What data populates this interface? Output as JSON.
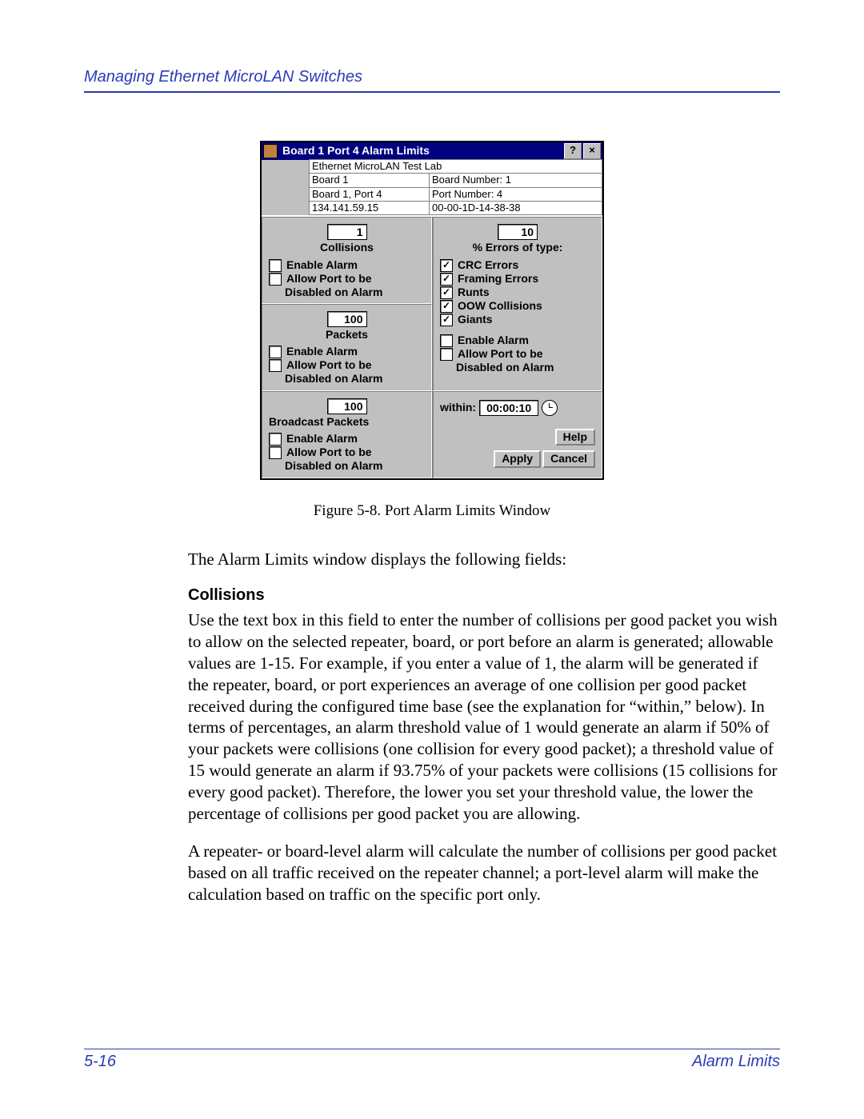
{
  "header": {
    "running": "Managing Ethernet MicroLAN Switches"
  },
  "dialog": {
    "title": "Board 1 Port 4 Alarm Limits",
    "info": {
      "lab": "Ethernet MicroLAN Test Lab",
      "board": "Board 1",
      "board_num": "Board Number:  1",
      "board_port": "Board 1, Port 4",
      "port_num": "Port Number:  4",
      "ip": "134.141.59.15",
      "mac": "00-00-1D-14-38-38"
    },
    "collisions": {
      "value": "1",
      "title": "Collisions",
      "enable": "Enable Alarm",
      "allow1": "Allow Port to be",
      "allow2": "Disabled on Alarm"
    },
    "errors": {
      "value": "10",
      "title": "% Errors of type:",
      "items": [
        "CRC Errors",
        "Framing Errors",
        "Runts",
        "OOW Collisions",
        "Giants"
      ],
      "enable": "Enable Alarm",
      "allow1": "Allow Port to be",
      "allow2": "Disabled on Alarm"
    },
    "packets": {
      "value": "100",
      "title": "Packets",
      "enable": "Enable Alarm",
      "allow1": "Allow Port to be",
      "allow2": "Disabled on Alarm"
    },
    "broadcast": {
      "value": "100",
      "title": "Broadcast Packets",
      "enable": "Enable Alarm",
      "allow1": "Allow Port to be",
      "allow2": "Disabled on Alarm"
    },
    "within_label": "within:",
    "within_value": "00:00:10",
    "buttons": {
      "help": "Help",
      "apply": "Apply",
      "cancel": "Cancel"
    }
  },
  "caption": "Figure 5-8. Port Alarm Limits Window",
  "body": {
    "intro": "The Alarm Limits window displays the following fields:",
    "h_collisions": "Collisions",
    "p1": "Use the text box in this field to enter the number of collisions per good packet you wish to allow on the selected repeater, board, or port before an alarm is generated; allowable values are 1-15. For example, if you enter a value of 1, the alarm will be generated if the repeater, board, or port experiences an average of one collision per good packet received during the configured time base (see the explanation for “within,” below). In terms of percentages, an alarm threshold value of 1 would generate an alarm if 50% of your packets were collisions (one collision for every good packet); a threshold value of 15 would generate an alarm if 93.75% of your packets were collisions (15 collisions for every good packet). Therefore, the lower you set your threshold value, the lower the percentage of collisions per good packet you are allowing.",
    "p2": "A repeater- or board-level alarm will calculate the number of collisions per good packet based on all traffic received on the repeater channel; a port-level alarm will make the calculation based on traffic on the specific port only."
  },
  "footer": {
    "page": "5-16",
    "section": "Alarm Limits"
  }
}
